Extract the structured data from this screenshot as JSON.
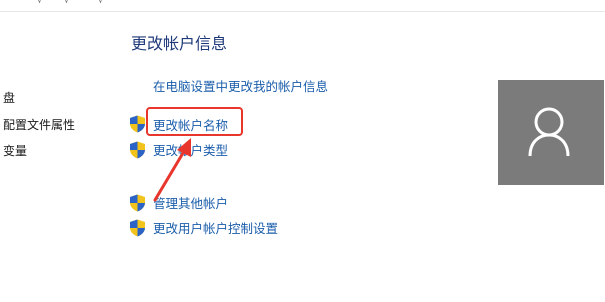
{
  "top_strip": {
    "glyphs": [
      "√",
      "√",
      "√"
    ]
  },
  "sidebar": {
    "items": [
      {
        "label": "盘"
      },
      {
        "label": "配置文件属性"
      },
      {
        "label": "变量"
      }
    ]
  },
  "main": {
    "section_title": "更改帐户信息",
    "links": [
      {
        "label": "在电脑设置中更改我的帐户信息",
        "shield": false
      },
      {
        "label": "更改帐户名称",
        "shield": true,
        "highlighted": true
      },
      {
        "label": "更改帐户类型",
        "shield": true
      },
      {
        "label": "管理其他帐户",
        "shield": true
      },
      {
        "label": "更改用户帐户控制设置",
        "shield": true
      }
    ]
  },
  "avatar": {
    "icon": "user-icon",
    "background": "#7b7b7b"
  },
  "annotation": {
    "box_color": "#e8362c",
    "arrow_color": "#e8362c"
  }
}
